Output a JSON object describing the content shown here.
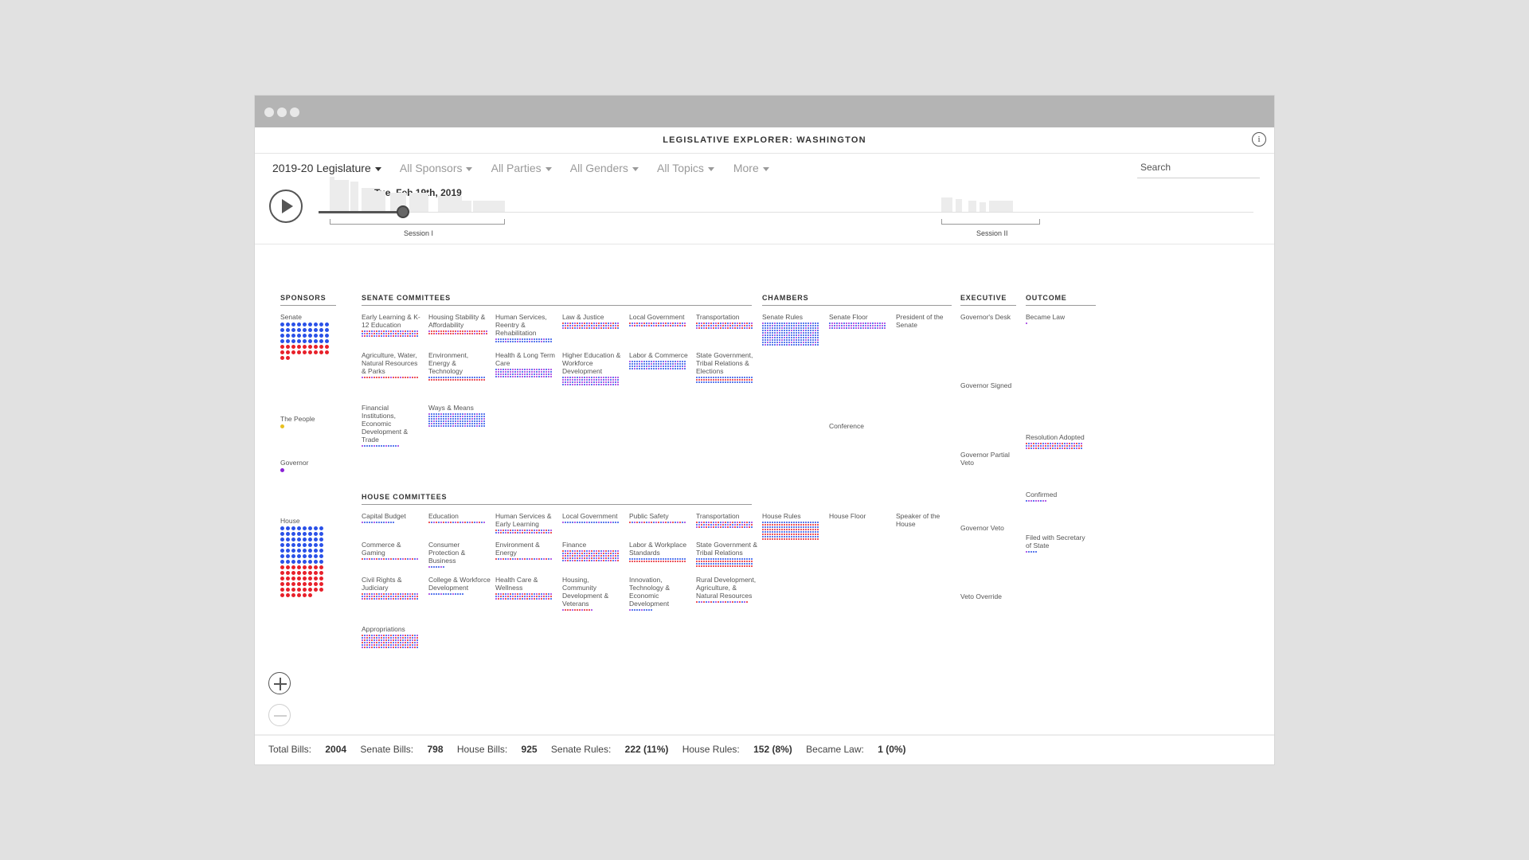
{
  "app_title": "LEGISLATIVE EXPLORER: WASHINGTON",
  "info_icon": "i",
  "filters": {
    "legislature": "2019-20 Legislature",
    "sponsors": "All Sponsors",
    "parties": "All Parties",
    "genders": "All Genders",
    "topics": "All Topics",
    "more": "More"
  },
  "search": {
    "placeholder": "Search"
  },
  "timeline": {
    "date": "Tue, Feb 19th, 2019",
    "progress": 0.09,
    "session1": "Session I",
    "session2": "Session II"
  },
  "headers": {
    "sponsors": "SPONSORS",
    "senate_committees": "SENATE COMMITTEES",
    "house_committees": "HOUSE COMMITTEES",
    "chambers": "CHAMBERS",
    "executive": "EXECUTIVE",
    "outcome": "OUTCOME"
  },
  "colors": {
    "republican": "#e8202a",
    "democrat": "#2a51e8",
    "mixed": "#9b2ee0",
    "people": "#e8c020",
    "governor": "#8a22d6"
  },
  "sponsors": {
    "senate": "Senate",
    "people": "The People",
    "governor": "Governor",
    "house": "House"
  },
  "senate_committees": [
    "Early Learning & K-12 Education",
    "Housing Stability & Affordability",
    "Human Services, Reentry & Rehabilitation",
    "Law & Justice",
    "Local Government",
    "Transportation",
    "Agriculture, Water, Natural Resources & Parks",
    "Environment, Energy & Technology",
    "Health & Long Term Care",
    "Higher Education & Workforce Development",
    "Labor & Commerce",
    "State Government, Tribal Relations & Elections",
    "Financial Institutions, Economic Development & Trade",
    "Ways & Means"
  ],
  "house_committees": [
    "Capital Budget",
    "Education",
    "Human Services & Early Learning",
    "Local Government",
    "Public Safety",
    "Transportation",
    "Commerce & Gaming",
    "Consumer Protection & Business",
    "Environment & Energy",
    "Finance",
    "Labor & Workplace Standards",
    "State Government & Tribal Relations",
    "Civil Rights & Judiciary",
    "College & Workforce Development",
    "Health Care & Wellness",
    "Housing, Community Development & Veterans",
    "Innovation, Technology & Economic Development",
    "Rural Development, Agriculture, & Natural Resources",
    "Appropriations"
  ],
  "chambers": {
    "senate_rules": "Senate Rules",
    "senate_floor": "Senate Floor",
    "president_senate": "President of the Senate",
    "conference": "Conference",
    "house_rules": "House Rules",
    "house_floor": "House Floor",
    "speaker_house": "Speaker of the House"
  },
  "executive": {
    "governors_desk": "Governor's Desk",
    "governor_signed": "Governor Signed",
    "governor_partial_veto": "Governor Partial Veto",
    "governor_veto": "Governor Veto",
    "veto_override": "Veto Override"
  },
  "outcome": {
    "became_law": "Became Law",
    "resolution_adopted": "Resolution Adopted",
    "confirmed": "Confirmed",
    "filed_secretary": "Filed with Secretary of State"
  },
  "stats": {
    "total_label": "Total Bills:",
    "total": "2004",
    "senate_label": "Senate Bills:",
    "senate": "798",
    "house_label": "House Bills:",
    "house": "925",
    "senate_rules_label": "Senate Rules:",
    "senate_rules": "222 (11%)",
    "house_rules_label": "House Rules:",
    "house_rules": "152 (8%)",
    "became_law_label": "Became Law:",
    "became_law": "1 (0%)"
  }
}
